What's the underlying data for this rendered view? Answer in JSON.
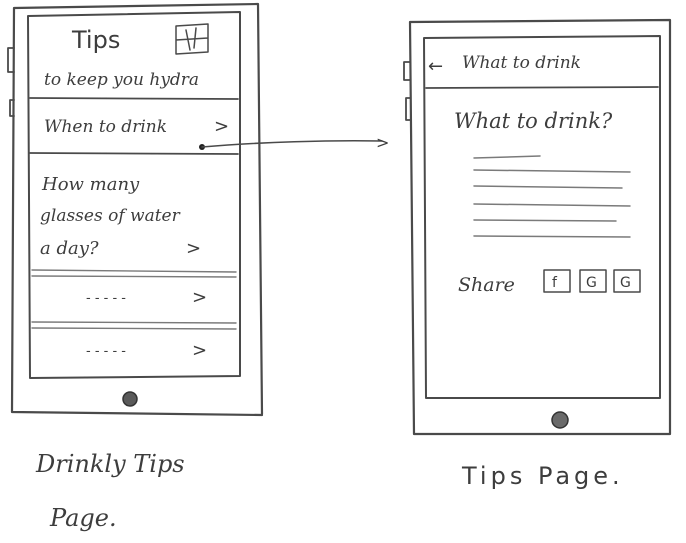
{
  "left_screen": {
    "title": "Tips",
    "subtitle": "to keep you hydra",
    "items": [
      {
        "label": "When to drink",
        "chevron": ">"
      },
      {
        "label_lines": [
          "How many",
          "glasses of water",
          "a day?"
        ],
        "chevron": ">"
      },
      {
        "label": "- - - - -",
        "chevron": ">"
      },
      {
        "label": "- - - - -",
        "chevron": ">"
      }
    ],
    "caption_lines": [
      "Drinkly Tips",
      "Page."
    ]
  },
  "right_screen": {
    "back_arrow": "←",
    "header_title": "What to drink",
    "heading": "What to drink?",
    "share_label": "Share",
    "share_icons": [
      "f",
      "G",
      "G"
    ],
    "caption": "Tips Page."
  },
  "connector": {
    "arrow_head": ">"
  }
}
